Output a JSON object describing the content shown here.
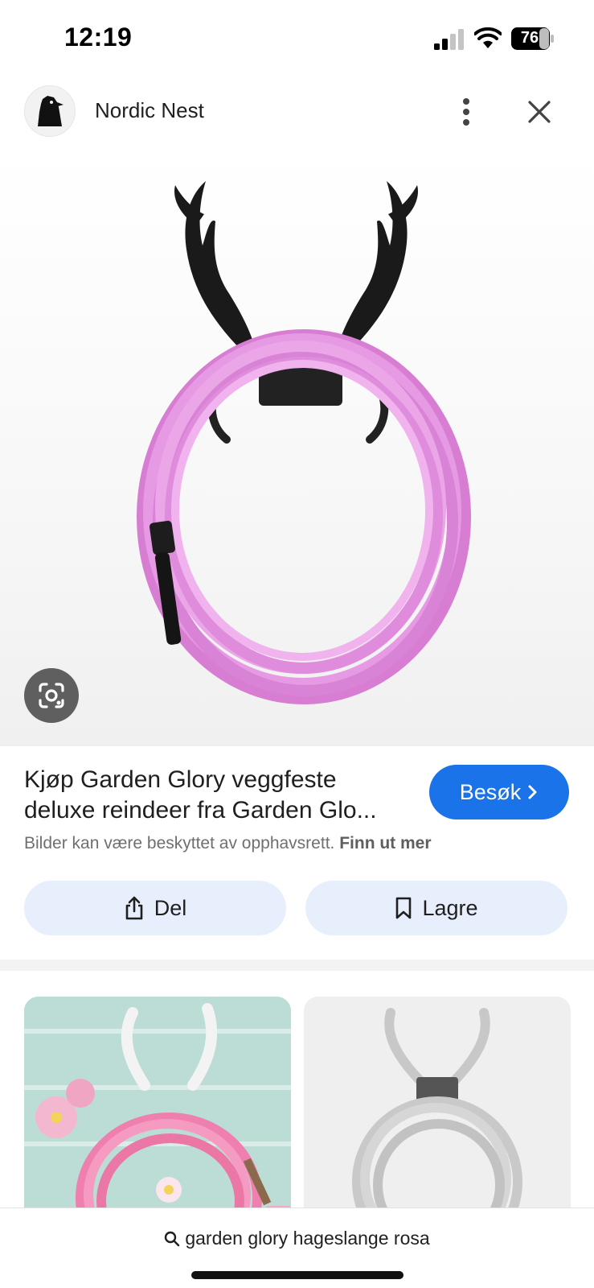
{
  "status_bar": {
    "time": "12:19",
    "battery_level": "76",
    "signal_bars": 2,
    "signal_bars_total": 4
  },
  "header": {
    "site_name": "Nordic Nest",
    "logo_icon": "nordic-nest-logo-icon",
    "more_icon": "more-vert-icon",
    "close_icon": "close-icon"
  },
  "main_image": {
    "lens_icon": "lens-search-icon"
  },
  "result": {
    "title_line1": "Kjøp Garden Glory veggfeste",
    "title_line2": "deluxe reindeer fra Garden Glo...",
    "visit_label": "Besøk",
    "visit_icon": "chevron-right-icon",
    "copyright_text": "Bilder kan være beskyttet av opphavsrett.",
    "learn_more": "Finn ut mer"
  },
  "actions": {
    "share_label": "Del",
    "share_icon": "share-icon",
    "save_label": "Lagre",
    "save_icon": "bookmark-icon"
  },
  "bottom_bar": {
    "search_icon": "search-icon",
    "query": "garden glory hageslange rosa"
  },
  "colors": {
    "accent": "#1a73e8",
    "action_bg": "#e8effc",
    "hose_pink": "#e58ee0"
  }
}
